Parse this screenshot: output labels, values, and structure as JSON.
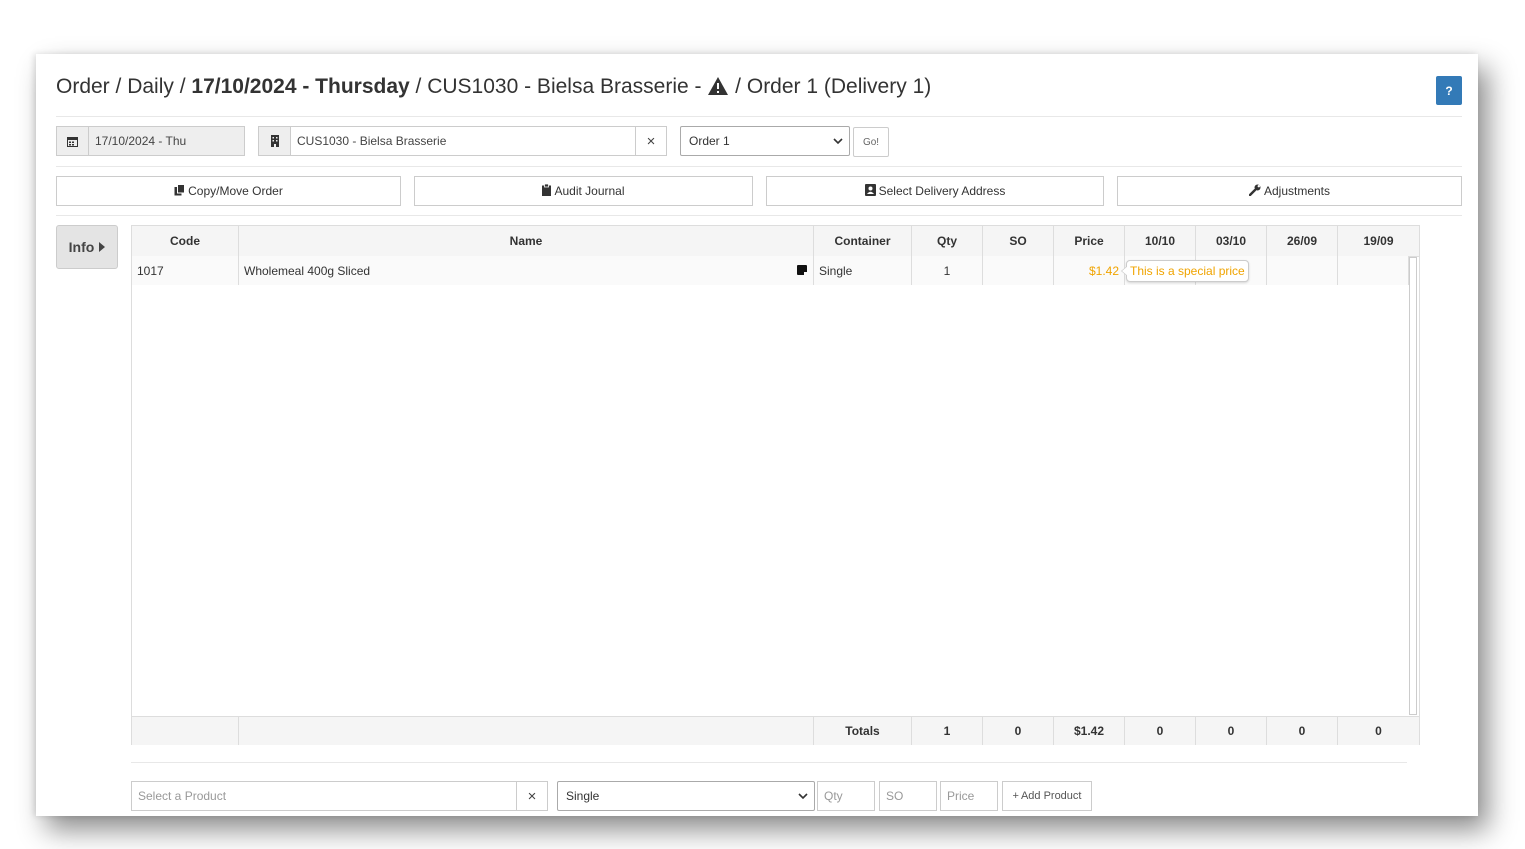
{
  "header": {
    "crumb_order": "Order",
    "sep": " / ",
    "crumb_daily": "Daily",
    "crumb_date": "17/10/2024 - Thursday",
    "crumb_customer": "CUS1030 - Bielsa Brasserie -",
    "crumb_order_no": "Order 1 (Delivery 1)",
    "help_label": "?"
  },
  "filters": {
    "date_value": "17/10/2024 - Thu",
    "customer_value": "CUS1030 - Bielsa Brasserie",
    "clear_label": "×",
    "order_select": "Order 1",
    "go_label": "Go!"
  },
  "actions": {
    "copy_move": "Copy/Move Order",
    "audit_journal": "Audit Journal",
    "select_delivery": "Select Delivery Address",
    "adjustments": "Adjustments"
  },
  "info_label": "Info",
  "grid": {
    "columns": [
      "Code",
      "Name",
      "Container",
      "Qty",
      "SO",
      "Price",
      "10/10",
      "03/10",
      "26/09",
      "19/09"
    ],
    "rows": [
      {
        "code": "1017",
        "name": "Wholemeal 400g Sliced",
        "container": "Single",
        "qty": "1",
        "so": "",
        "price": "$1.42",
        "h1": "",
        "h2": "",
        "h3": "",
        "h4": ""
      }
    ],
    "totals": {
      "label": "Totals",
      "qty": "1",
      "so": "0",
      "price": "$1.42",
      "h1": "0",
      "h2": "0",
      "h3": "0",
      "h4": "0"
    },
    "price_tooltip": "This is a special price"
  },
  "add_product": {
    "product_placeholder": "Select a Product",
    "clear_label": "×",
    "container_select": "Single",
    "qty_placeholder": "Qty",
    "so_placeholder": "SO",
    "price_placeholder": "Price",
    "add_label": "Add Product",
    "add_plus": "+"
  },
  "colors": {
    "accent": "#337ab7",
    "special_price": "#f0a400"
  },
  "icons": [
    "calendar-icon",
    "building-icon",
    "copy-icon",
    "clipboard-icon",
    "address-card-icon",
    "wrench-icon",
    "caret-right-icon",
    "warning-icon",
    "note-icon"
  ]
}
